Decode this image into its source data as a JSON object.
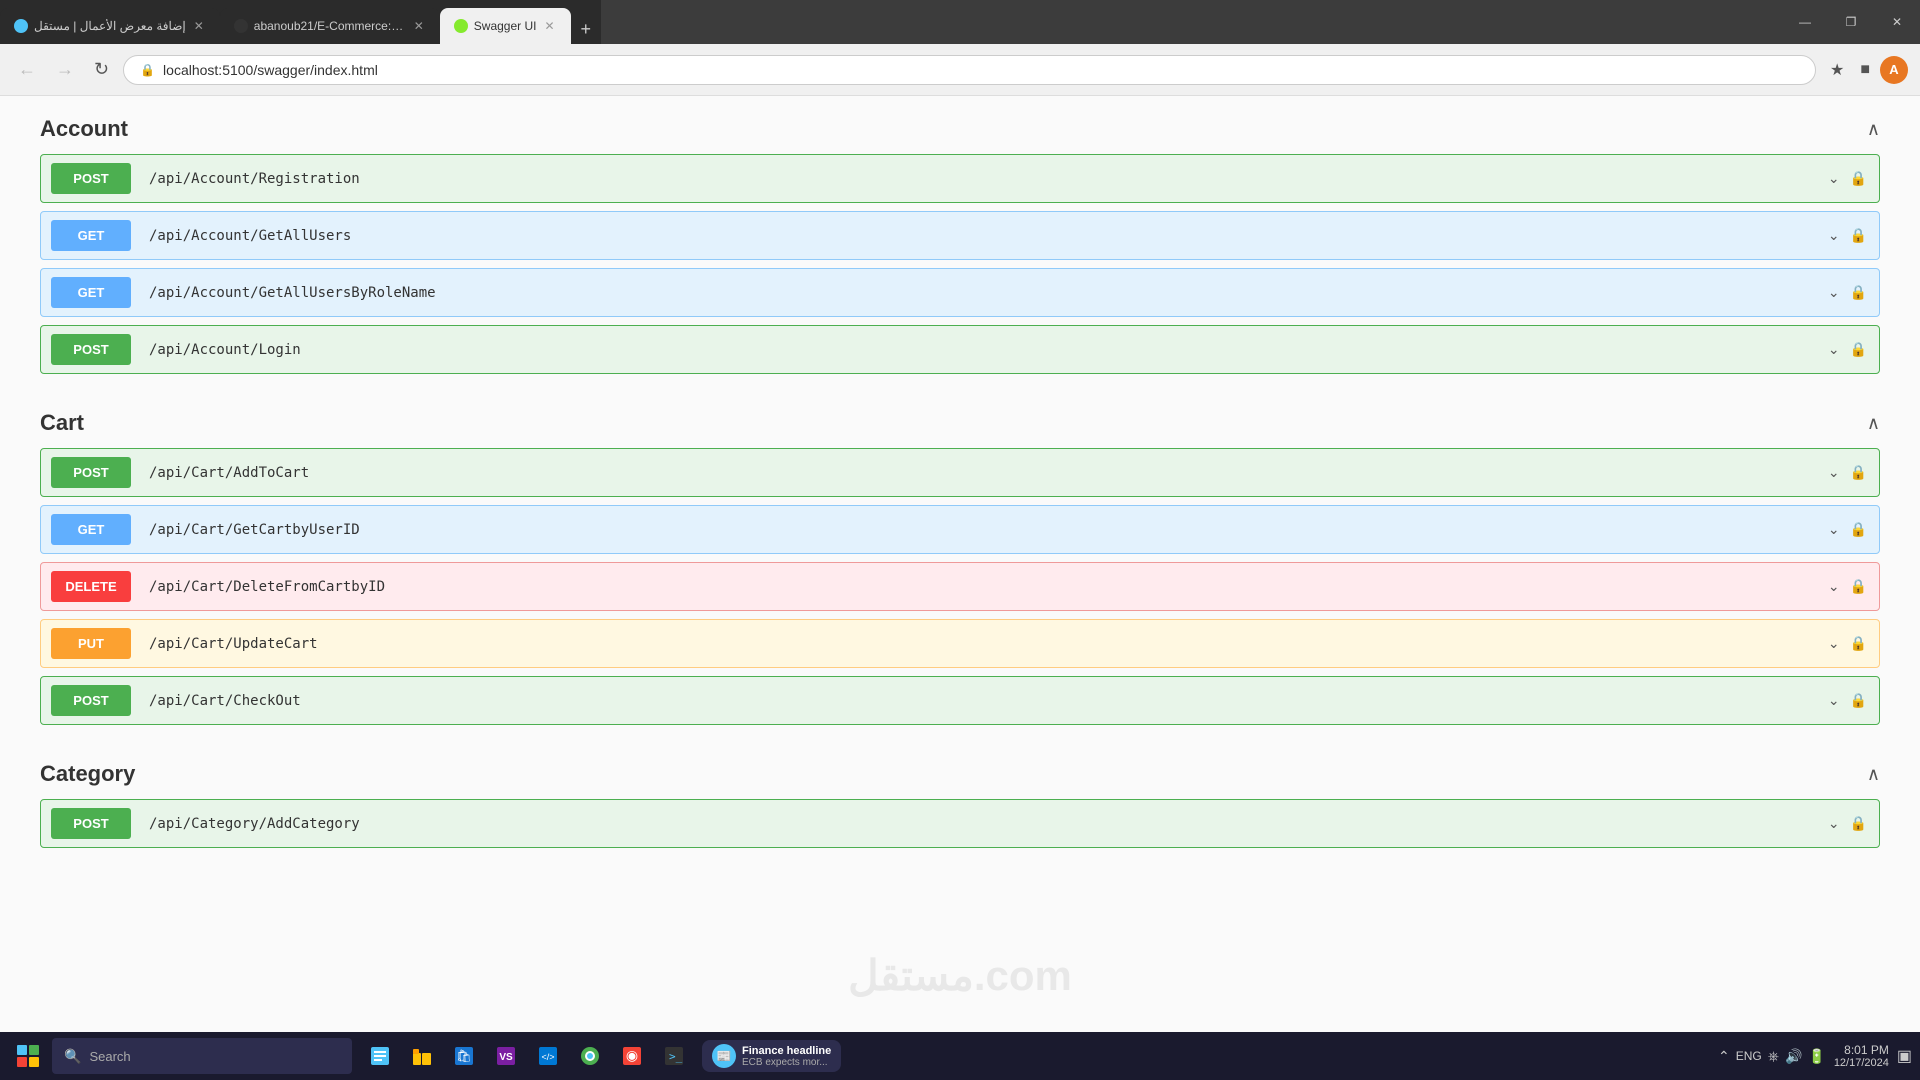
{
  "browser": {
    "tabs": [
      {
        "id": "tab1",
        "title": "إضافة معرض الأعمال | مستقل",
        "favicon_color": "#4fc3f7",
        "active": false
      },
      {
        "id": "tab2",
        "title": "abanoub21/E-Commerce: e-co",
        "favicon_color": "#333",
        "active": false
      },
      {
        "id": "tab3",
        "title": "Swagger UI",
        "favicon_color": "#85ea2d",
        "active": true
      }
    ],
    "address": "localhost:5100/swagger/index.html",
    "window_controls": {
      "minimize": "—",
      "maximize": "❐",
      "close": "✕"
    }
  },
  "swagger": {
    "sections": [
      {
        "id": "account",
        "title": "Account",
        "endpoints": [
          {
            "method": "POST",
            "path": "/api/Account/Registration"
          },
          {
            "method": "GET",
            "path": "/api/Account/GetAllUsers"
          },
          {
            "method": "GET",
            "path": "/api/Account/GetAllUsersByRoleName"
          },
          {
            "method": "POST",
            "path": "/api/Account/Login"
          }
        ]
      },
      {
        "id": "cart",
        "title": "Cart",
        "endpoints": [
          {
            "method": "POST",
            "path": "/api/Cart/AddToCart"
          },
          {
            "method": "GET",
            "path": "/api/Cart/GetCartbyUserID"
          },
          {
            "method": "DELETE",
            "path": "/api/Cart/DeleteFromCartbyID"
          },
          {
            "method": "PUT",
            "path": "/api/Cart/UpdateCart"
          },
          {
            "method": "POST",
            "path": "/api/Cart/CheckOut"
          }
        ]
      },
      {
        "id": "category",
        "title": "Category",
        "endpoints": [
          {
            "method": "POST",
            "path": "/api/Category/AddCategory"
          }
        ]
      }
    ]
  },
  "taskbar": {
    "search_placeholder": "Search",
    "news": {
      "title": "Finance headline",
      "subtitle": "ECB expects mor..."
    },
    "sys_tray": {
      "lang": "ENG",
      "time": "8:01 PM",
      "date": "12/17/2024"
    }
  },
  "watermark": "مستقل.com"
}
